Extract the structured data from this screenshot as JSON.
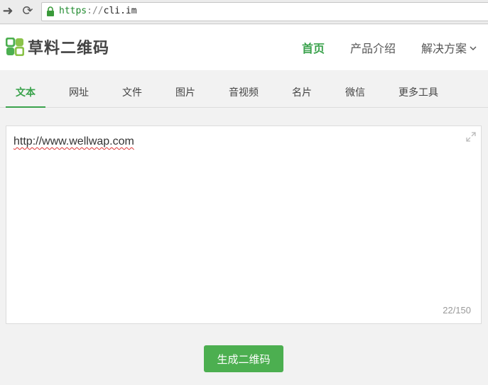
{
  "browser": {
    "url_scheme": "https",
    "url_separator": "://",
    "url_host": "cli.im"
  },
  "header": {
    "logo_text": "草料二维码",
    "nav": [
      {
        "label": "首页",
        "active": true
      },
      {
        "label": "产品介绍",
        "active": false
      },
      {
        "label": "解决方案",
        "active": false
      }
    ]
  },
  "tabs": [
    {
      "label": "文本",
      "active": true
    },
    {
      "label": "网址",
      "active": false
    },
    {
      "label": "文件",
      "active": false
    },
    {
      "label": "图片",
      "active": false
    },
    {
      "label": "音视频",
      "active": false
    },
    {
      "label": "名片",
      "active": false
    },
    {
      "label": "微信",
      "active": false
    },
    {
      "label": "更多工具",
      "active": false
    }
  ],
  "editor": {
    "value": "http://www.wellwap.com",
    "char_count": "22/150"
  },
  "actions": {
    "generate_label": "生成二维码"
  },
  "colors": {
    "accent": "#3aa24c",
    "button": "#4caf50"
  }
}
